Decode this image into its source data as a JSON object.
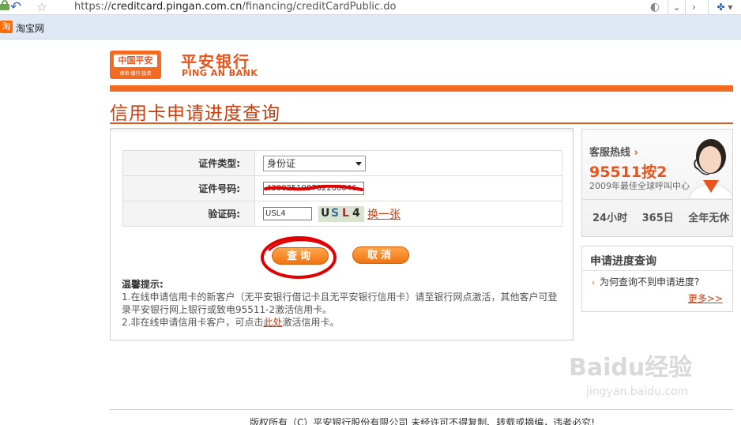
{
  "browser": {
    "url_prefix": "https://",
    "url_host": "creditcard.pingan.com.cn",
    "url_path": "/financing/creditCardPublic.do",
    "bookmark_icon_text": "淘",
    "bookmark_label": "淘宝网"
  },
  "brand": {
    "logo_text": "中国平安",
    "logo_tagline": "保险·银行·投资",
    "name_cn": "平安银行",
    "name_en": "PING AN BANK",
    "accent_color": "#e8541a"
  },
  "page": {
    "title": "信用卡申请进度查询"
  },
  "form": {
    "id_type_label": "证件类型:",
    "id_type_value": "身份证",
    "id_number_label": "证件号码:",
    "id_number_value": "430025198702200046",
    "captcha_label": "验证码:",
    "captcha_value": "USL4",
    "captcha_chars": [
      "U",
      "S",
      "L",
      "4"
    ],
    "change_captcha_link": "换一张",
    "query_button": "查询",
    "cancel_button": "取消"
  },
  "tips": {
    "heading": "温馨提示:",
    "line1": "1.在线申请信用卡的新客户（无平安银行借记卡且无平安银行信用卡）请至银行网点激活，其他客户可登录平安银行网上银行或致电95511-2激活信用卡。",
    "line2_before": "2.非在线申请信用卡客户，可点击",
    "line2_link": "此处",
    "line2_after": "激活信用卡。"
  },
  "sidebar": {
    "hotline_label": "客服热线",
    "hotline_number": "95511按2",
    "hotline_award": "2009年最佳全球呼叫中心",
    "service_hours": "24小时 365日 全年无休",
    "progress_title": "申请进度查询",
    "progress_faq": "为何查询不到申请进度?",
    "more_link": "更多>>"
  },
  "footer": {
    "text": "版权所有（C）平安银行股份有限公司 未经许可不得复制、转载或摘编，违者必究!"
  },
  "watermark": {
    "brand": "Baidu经验",
    "url": "jingyan.baidu.com"
  }
}
